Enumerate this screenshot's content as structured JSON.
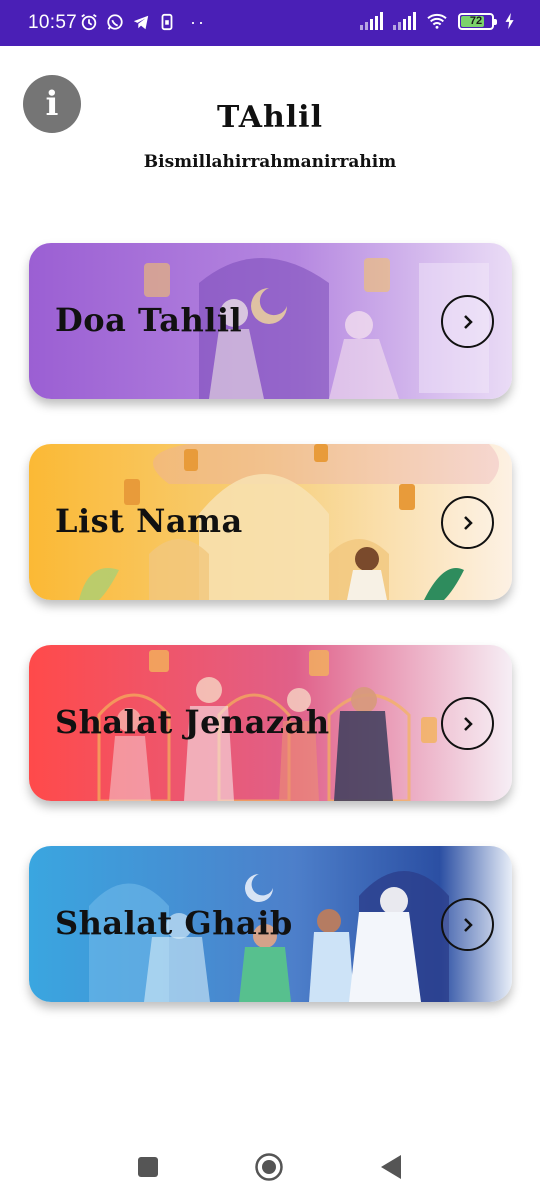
{
  "status_bar": {
    "time": "10:57",
    "battery": "72",
    "colors": {
      "background": "#4a1fb6",
      "battery_fill": "#7bd36b"
    },
    "icons": [
      "alarm-icon",
      "whatsapp-icon",
      "telegram-icon",
      "sim-icon",
      "more-dots-icon",
      "signal-icon",
      "signal-icon",
      "wifi-icon",
      "battery-icon",
      "charging-icon"
    ]
  },
  "header": {
    "title": "TAhlil",
    "subtitle": "Bismillahirrahmanirrahim",
    "info_icon": "info-icon"
  },
  "menu": {
    "items": [
      {
        "label": "Doa Tahlil",
        "icon": "chevron-right-icon",
        "colors": [
          "#9b5fd3",
          "#c79be6"
        ]
      },
      {
        "label": "List Nama",
        "icon": "chevron-right-icon",
        "colors": [
          "#fbb935",
          "#f7e1c0"
        ]
      },
      {
        "label": "Shalat Jenazah",
        "icon": "chevron-right-icon",
        "colors": [
          "#ff4a4a",
          "#c45fa8"
        ]
      },
      {
        "label": "Shalat Ghaib",
        "icon": "chevron-right-icon",
        "colors": [
          "#3aa6e0",
          "#2b4fa3"
        ]
      }
    ]
  },
  "nav_bar": {
    "icons": [
      "recents-square-icon",
      "home-circle-icon",
      "back-triangle-icon"
    ]
  }
}
